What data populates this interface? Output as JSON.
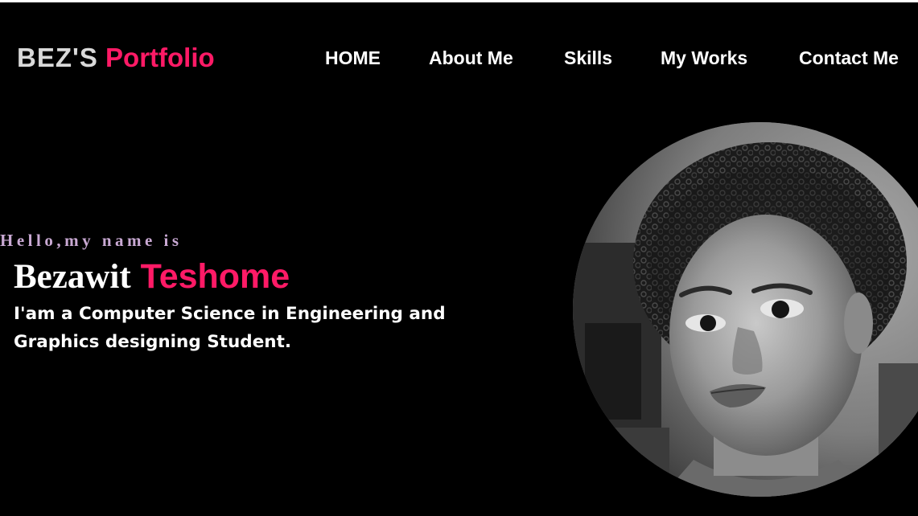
{
  "brand": {
    "first": "BEZ'S",
    "second": "Portfolio"
  },
  "nav": {
    "items": [
      {
        "label": "HOME"
      },
      {
        "label": "About Me"
      },
      {
        "label": "Skills"
      },
      {
        "label": "My Works"
      },
      {
        "label": "Contact Me"
      }
    ]
  },
  "hero": {
    "greeting": "Hello,my name is",
    "first_name": "Bezawit",
    "last_name": "Teshome",
    "tagline": "I'am a Computer Science in Engineering and Graphics designing Student."
  },
  "colors": {
    "background": "#000000",
    "accent": "#ff1a66",
    "greeting": "#c9a9d3"
  }
}
